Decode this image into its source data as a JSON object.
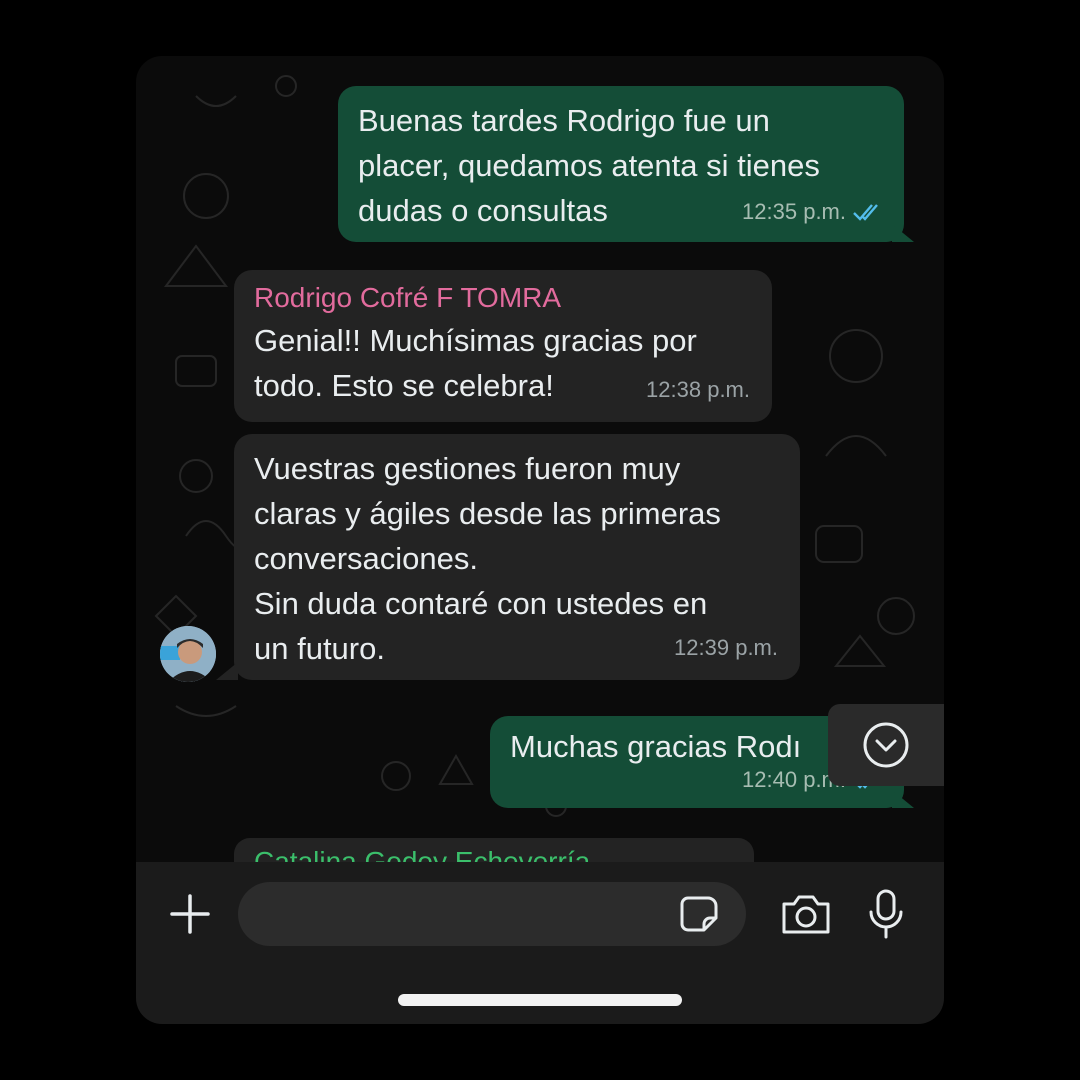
{
  "messages": [
    {
      "direction": "outgoing",
      "text": "Buenas tardes Rodrigo fue un\nplacer, quedamos atenta si tienes\ndudas o consultas",
      "time": "12:35 p.m.",
      "status": "read"
    },
    {
      "direction": "incoming",
      "sender": "Rodrigo Cofré F TOMRA",
      "text": "Genial!! Muchísimas gracias por\ntodo. Esto se celebra!",
      "time": "12:38 p.m."
    },
    {
      "direction": "incoming",
      "text": "Vuestras gestiones fueron muy\nclaras y ágiles desde las primeras\nconversaciones.\nSin duda contaré con ustedes en\nun futuro.",
      "time": "12:39 p.m."
    },
    {
      "direction": "outgoing",
      "text": "Muchas gracias Rodı",
      "time": "12:40 p.m.",
      "status": "read"
    }
  ],
  "next_sender_partial": "Catalina Godoy Echeverría",
  "composer": {
    "placeholder": ""
  },
  "icons": {
    "attach": "plus-icon",
    "sticker": "sticker-icon",
    "camera": "camera-icon",
    "mic": "microphone-icon",
    "scroll": "chevron-down-icon",
    "read_ticks": "double-check-icon"
  },
  "colors": {
    "outgoing_bubble": "#144d37",
    "incoming_bubble": "#232323",
    "sender_name": "#e26b9d",
    "read_ticks": "#53bdeb",
    "next_sender": "#3bbf6b"
  }
}
